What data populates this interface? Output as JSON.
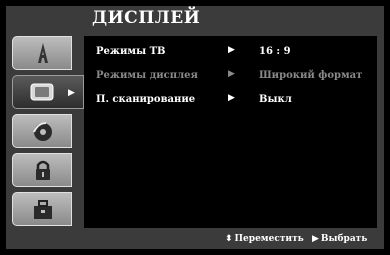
{
  "menu": {
    "title": "ДИСПЛЕЙ",
    "tabs": [
      {
        "name": "language-tab",
        "icon": "letter-a-icon",
        "active": false
      },
      {
        "name": "display-tab",
        "icon": "tv-screen-icon",
        "active": true
      },
      {
        "name": "audio-tab",
        "icon": "disc-icon",
        "active": false
      },
      {
        "name": "lock-tab",
        "icon": "padlock-icon",
        "active": false
      },
      {
        "name": "others-tab",
        "icon": "toolbox-icon",
        "active": false
      }
    ],
    "items": [
      {
        "label": "Режимы ТВ",
        "value": "16 : 9",
        "enabled": true
      },
      {
        "label": "Режимы дисплея",
        "value": "Широкий формат",
        "enabled": false
      },
      {
        "label": "П. сканирование",
        "value": "Выкл",
        "enabled": true
      }
    ],
    "arrow": "▶"
  },
  "footer": {
    "move_glyph": "⬍",
    "move_label": "Переместить",
    "select_glyph": "▶",
    "select_label": "Выбрать"
  }
}
